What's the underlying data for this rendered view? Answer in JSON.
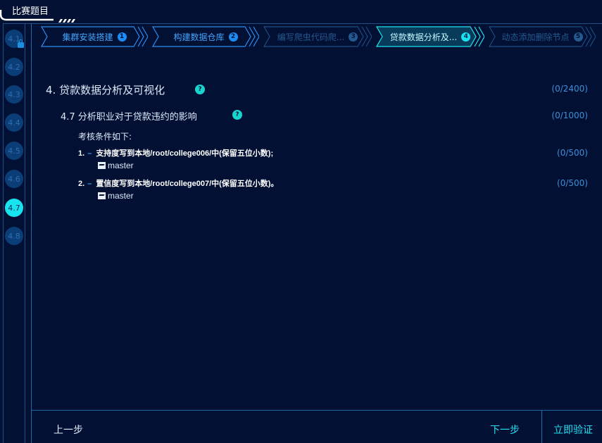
{
  "header": {
    "title": "比赛题目"
  },
  "steps": [
    "4.1",
    "4.2",
    "4.3",
    "4.4",
    "4.5",
    "4.6",
    "4.7",
    "4.8"
  ],
  "active_step": "4.7",
  "breadcrumbs": [
    {
      "label": "集群安装搭建",
      "num": "1"
    },
    {
      "label": "构建数据仓库",
      "num": "2"
    },
    {
      "label": "编写爬虫代码爬...",
      "num": "3"
    },
    {
      "label": "贷款数据分析及...",
      "num": "4"
    },
    {
      "label": "动态添加删除节点",
      "num": "5"
    }
  ],
  "section": {
    "title": "4. 贷款数据分析及可视化",
    "score": "(0/2400)"
  },
  "subsection": {
    "title": "4.7 分析职业对于贷款违约的影响",
    "score": "(0/1000)"
  },
  "conditions_header": "考核条件如下:",
  "conditions": [
    {
      "index": "1.",
      "text": "支持度写到本地/root/college006/中(保留五位小数);",
      "host": "master",
      "score": "(0/500)"
    },
    {
      "index": "2.",
      "text": "置信度写到本地/root/college007/中(保留五位小数)。",
      "host": "master",
      "score": "(0/500)"
    }
  ],
  "help_icon": "?",
  "footer": {
    "prev": "上一步",
    "next": "下一步",
    "verify": "立即验证"
  },
  "colors": {
    "background": "#021034",
    "accent": "#19e3f0",
    "link": "#42a6ff"
  }
}
